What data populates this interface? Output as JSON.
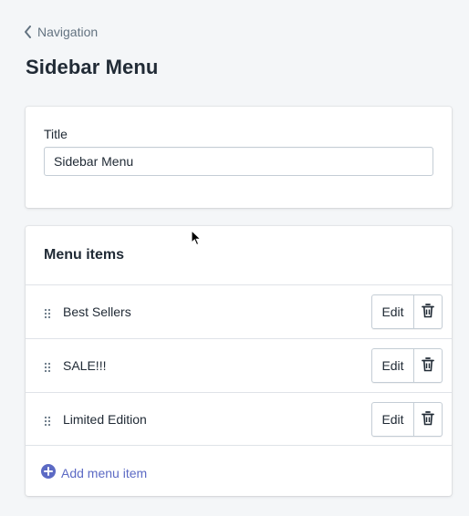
{
  "breadcrumb": {
    "label": "Navigation"
  },
  "page": {
    "title": "Sidebar Menu"
  },
  "title_section": {
    "label": "Title",
    "input_value": "Sidebar Menu"
  },
  "menu_section": {
    "heading": "Menu items",
    "items": [
      {
        "label": "Best Sellers",
        "edit_label": "Edit"
      },
      {
        "label": "SALE!!!",
        "edit_label": "Edit"
      },
      {
        "label": "Limited Edition",
        "edit_label": "Edit"
      }
    ],
    "add_label": "Add menu item"
  },
  "icons": {
    "back": "chevron-left-icon",
    "drag": "drag-handle-icon",
    "delete": "trash-icon",
    "add": "plus-circle-icon",
    "pointer": "mouse-cursor-icon"
  },
  "colors": {
    "background": "#f4f6f8",
    "text": "#212b36",
    "subdued": "#637381",
    "accent": "#5c6ac4",
    "border": "#c4cdd5"
  }
}
